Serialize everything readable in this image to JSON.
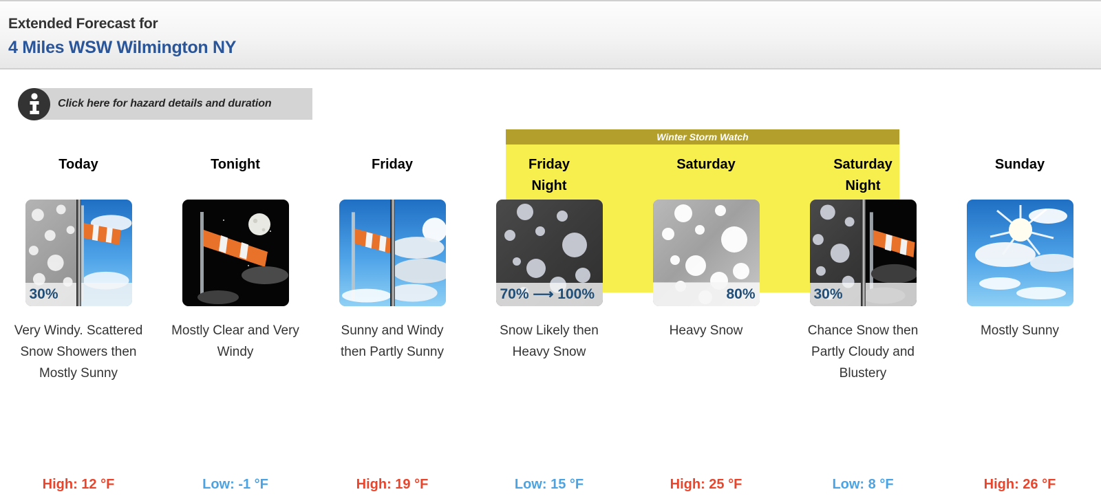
{
  "header": {
    "line1": "Extended Forecast for",
    "line2": "4 Miles WSW Wilmington NY"
  },
  "hazard": {
    "icon": "info-icon",
    "text": "Click here for hazard details and duration"
  },
  "watch": {
    "label": "Winter Storm Watch",
    "banner_color": "#b3a02c",
    "highlight_color": "#f6ef4e"
  },
  "colors": {
    "high_temp": "#e8452c",
    "low_temp": "#4ba3e3",
    "location_link": "#2a5599",
    "pop_text": "#1f4e79"
  },
  "periods": [
    {
      "day": "Today",
      "icon": "snow-windy-day-icon",
      "pop": "30%",
      "pop_align": "left",
      "description": "Very Windy. Scattered Snow Showers then Mostly Sunny",
      "temp_label": "High: 12 °F",
      "temp_type": "high",
      "in_watch": false
    },
    {
      "day": "Tonight",
      "icon": "windy-night-icon",
      "pop": "",
      "pop_align": "left",
      "description": "Mostly Clear and Very Windy",
      "temp_label": "Low: -1 °F",
      "temp_type": "low",
      "in_watch": false
    },
    {
      "day": "Friday",
      "icon": "windy-partly-sunny-icon",
      "pop": "",
      "pop_align": "left",
      "description": "Sunny and Windy then Partly Sunny",
      "temp_label": "High: 19 °F",
      "temp_type": "high",
      "in_watch": false
    },
    {
      "day": "Friday Night",
      "icon": "snow-night-icon",
      "pop": "70% ⟶ 100%",
      "pop_align": "left",
      "description": "Snow Likely then Heavy Snow",
      "temp_label": "Low: 15 °F",
      "temp_type": "low",
      "in_watch": true
    },
    {
      "day": "Saturday",
      "icon": "heavy-snow-icon",
      "pop": "80%",
      "pop_align": "right",
      "description": "Heavy Snow",
      "temp_label": "High: 25 °F",
      "temp_type": "high",
      "in_watch": true
    },
    {
      "day": "Saturday Night",
      "icon": "snow-windy-night-icon",
      "pop": "30%",
      "pop_align": "left",
      "description": "Chance Snow then Partly Cloudy and Blustery",
      "temp_label": "Low: 8 °F",
      "temp_type": "low",
      "in_watch": true
    },
    {
      "day": "Sunday",
      "icon": "mostly-sunny-icon",
      "pop": "",
      "pop_align": "left",
      "description": "Mostly Sunny",
      "temp_label": "High: 26 °F",
      "temp_type": "high",
      "in_watch": false
    }
  ]
}
